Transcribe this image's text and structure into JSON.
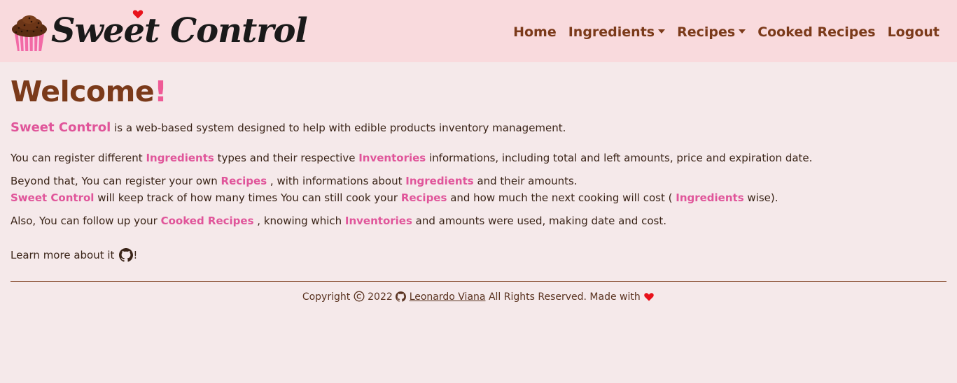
{
  "brand": {
    "name": "Sweet Control",
    "logo_icon": "cupcake-icon"
  },
  "nav": {
    "items": [
      {
        "label": "Home",
        "dropdown": false
      },
      {
        "label": "Ingredients",
        "dropdown": true
      },
      {
        "label": "Recipes",
        "dropdown": true
      },
      {
        "label": "Cooked Recipes",
        "dropdown": false
      },
      {
        "label": "Logout",
        "dropdown": false
      }
    ]
  },
  "main": {
    "title": "Welcome",
    "title_suffix": "!",
    "p1": {
      "brand": "Sweet Control",
      "text": " is a web-based system designed to help with edible products inventory management."
    },
    "p2": {
      "t1": "You can register different ",
      "h1": "Ingredients",
      "t2": " types and their respective ",
      "h2": "Inventories",
      "t3": " informations, including total and left amounts, price and expiration date."
    },
    "p3": {
      "t1": "Beyond that, You can register your own ",
      "h1": "Recipes",
      "t2": " , with informations about ",
      "h2": "Ingredients",
      "t3": " and their amounts."
    },
    "p4": {
      "h1": "Sweet Control",
      "t1": " will keep track of how many times You can still cook your ",
      "h2": "Recipes",
      "t2": " and how much the next cooking will cost ( ",
      "h3": "Ingredients",
      "t3": " wise)."
    },
    "p5": {
      "t1": "Also, You can follow up your ",
      "h1": "Cooked Recipes",
      "t2": " , knowing which ",
      "h2": "Inventories",
      "t3": " and amounts were used, making date and cost."
    },
    "p6": {
      "t1": "Learn more about it ",
      "t2": "!",
      "icon": "github-icon"
    }
  },
  "footer": {
    "copyright": "Copyright",
    "year": "2022",
    "author": "Leonardo Viana",
    "rights": "All Rights Reserved. Made with",
    "heart_icon": "heart-icon"
  },
  "colors": {
    "navbar_bg": "#f9dadd",
    "page_bg": "#f5e9ea",
    "brown": "#7b3a1a",
    "pink": "#e0559a",
    "heart": "#e8121b"
  }
}
